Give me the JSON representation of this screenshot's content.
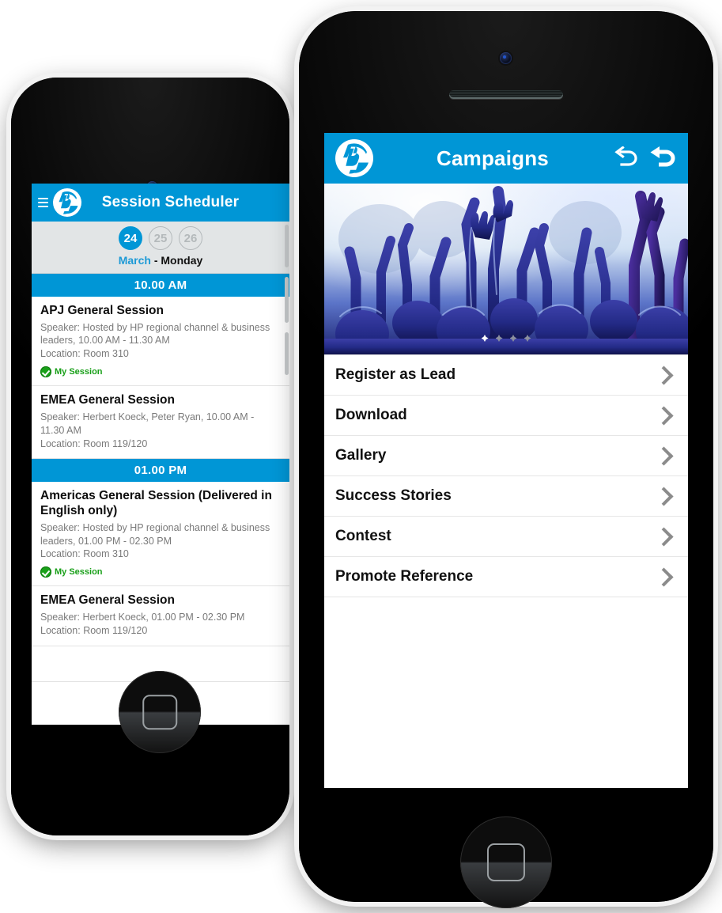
{
  "brand": {
    "name": "hp",
    "accent": "#0096d6"
  },
  "left_phone": {
    "header": {
      "title": "Session Scheduler",
      "menu_icon": "hamburger-icon",
      "logo": "hp-logo"
    },
    "date_selector": {
      "days": [
        {
          "num": "24",
          "selected": true
        },
        {
          "num": "25",
          "selected": false
        },
        {
          "num": "26",
          "selected": false
        }
      ],
      "month": "March",
      "weekday": "- Monday"
    },
    "groups": [
      {
        "time": "10.00 AM",
        "sessions": [
          {
            "title": "APJ General Session",
            "speaker": "Speaker: Hosted by HP regional channel & business leaders, 10.00 AM - 11.30 AM",
            "location": "Location: Room 310",
            "badge": "My Session"
          },
          {
            "title": "EMEA General Session",
            "speaker": "Speaker: Herbert Koeck, Peter Ryan, 10.00 AM - 11.30 AM",
            "location": "Location: Room 119/120",
            "badge": null
          }
        ]
      },
      {
        "time": "01.00 PM",
        "sessions": [
          {
            "title": "Americas General Session (Delivered in English only)",
            "speaker": "Speaker: Hosted by HP regional channel & business leaders, 01.00 PM - 02.30 PM",
            "location": "Location: Room 310",
            "badge": "My Session"
          },
          {
            "title": "EMEA General Session",
            "speaker": "Speaker: Herbert Koeck,  01.00 PM - 02.30 PM",
            "location": "Location: Room 119/120",
            "badge": null
          }
        ]
      }
    ]
  },
  "right_phone": {
    "header": {
      "title": "Campaigns",
      "logo": "hp-logo",
      "actions": [
        "undo-arrow-icon",
        "back-arrow-icon"
      ]
    },
    "banner": {
      "alt": "concert-crowd-raised-hands-photo",
      "dots": [
        true,
        false,
        false,
        false
      ]
    },
    "menu": [
      {
        "label": "Register as Lead"
      },
      {
        "label": "Download"
      },
      {
        "label": "Gallery"
      },
      {
        "label": "Success Stories"
      },
      {
        "label": "Contest"
      },
      {
        "label": "Promote Reference"
      }
    ]
  }
}
